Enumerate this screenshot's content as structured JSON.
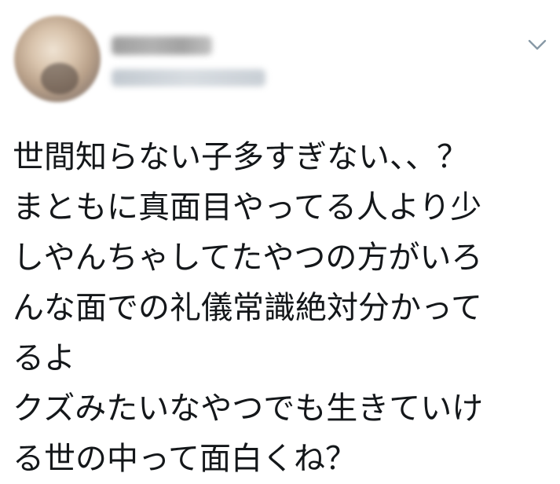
{
  "tweet": {
    "author": {
      "display_name": "",
      "handle": ""
    },
    "menu_icon": "chevron-down-icon",
    "text_lines": [
      "世間知らない子多すぎない、、？",
      "まともに真面目やってる人より少",
      "しやんちゃしてたやつの方がいろ",
      "んな面での礼儀常識絶対分かって",
      "るよ",
      "クズみたいなやつでも生きていけ",
      "る世の中って面白くね？"
    ]
  }
}
